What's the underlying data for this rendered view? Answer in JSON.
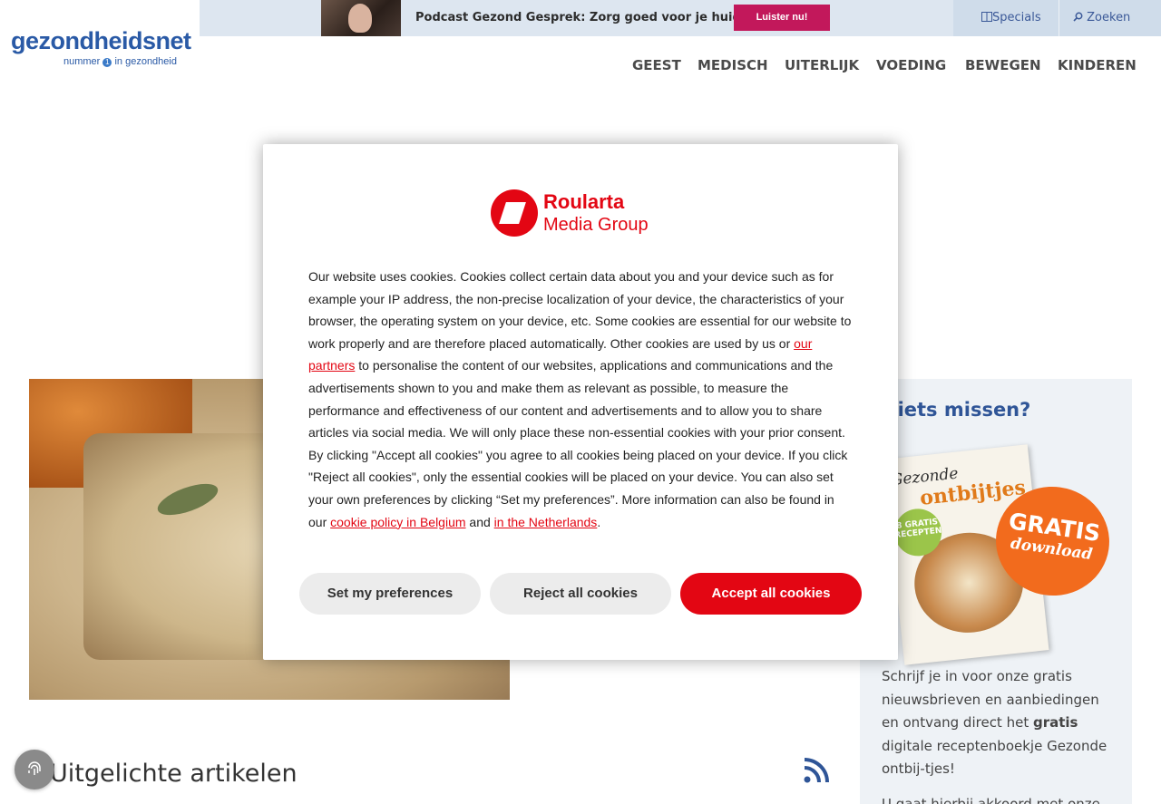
{
  "header": {
    "logo_text": "gezondheidsnet",
    "logo_tagline_before": "nummer",
    "logo_tagline_num": "1",
    "logo_tagline_after": "in gezondheid",
    "podcast_text": "Podcast Gezond Gesprek: Zorg goed voor je huid",
    "podcast_button": "Luister nu!",
    "specials_label": "Specials",
    "search_label": "Zoeken",
    "nav": [
      "GEEST",
      "MEDISCH",
      "UITERLIJK",
      "VOEDING",
      "BEWEGEN",
      "KINDEREN"
    ]
  },
  "sidebar": {
    "title": "Niets missen?",
    "promo_title_1": "Gezonde",
    "promo_title_2": "ontbijtjes",
    "promo_badge": "8 GRATIS RECEPTEN",
    "gratis_1": "GRATIS",
    "gratis_2": "download",
    "text_before": "Schrijf je in voor onze gratis nieuwsbrieven en aanbiedingen en ontvang direct het",
    "text_bold": "gratis",
    "text_after": "digitale receptenboekje Gezonde ontbij-tjes!",
    "text_2": "U gaat hierbij akkoord met onze"
  },
  "main": {
    "featured_title": "Uitgelichte artikelen"
  },
  "consent": {
    "brand_line1": "Roularta",
    "brand_line2": "Media Group",
    "text_1": "Our website uses cookies. Cookies collect certain data about you and your device such as for example your IP address, the non-precise localization of your device, the characteristics of your browser, the operating system on your device, etc. Some cookies are essential for our website to work properly and are therefore placed automatically. Other cookies are used by us or",
    "link_partners": "our partners",
    "text_2": "to personalise the content of our websites, applications and communications and the advertisements shown to you and make them as relevant as possible, to measure the performance and effectiveness of our content and advertisements and to allow you to share articles via social media. We will only place these non-essential cookies with your prior consent. By clicking \"Accept all cookies\" you agree to all cookies being placed on your device. If you click \"Reject all cookies\", only the essential cookies will be placed on your device. You can also set your own preferences by clicking “Set my preferences”. More information can also be found in our",
    "link_belgium": "cookie policy in Belgium",
    "text_and": "and",
    "link_netherlands": "in the Netherlands",
    "text_end": ".",
    "btn_preferences": "Set my preferences",
    "btn_reject": "Reject all cookies",
    "btn_accept": "Accept all cookies"
  },
  "colors": {
    "brand_red": "#e30613",
    "podcast_button": "#c2185b",
    "nav_text": "#4a4a4a",
    "link_blue": "#2f5597"
  },
  "icons": [
    "book-icon",
    "search-icon",
    "rss-icon",
    "fingerprint-icon"
  ]
}
